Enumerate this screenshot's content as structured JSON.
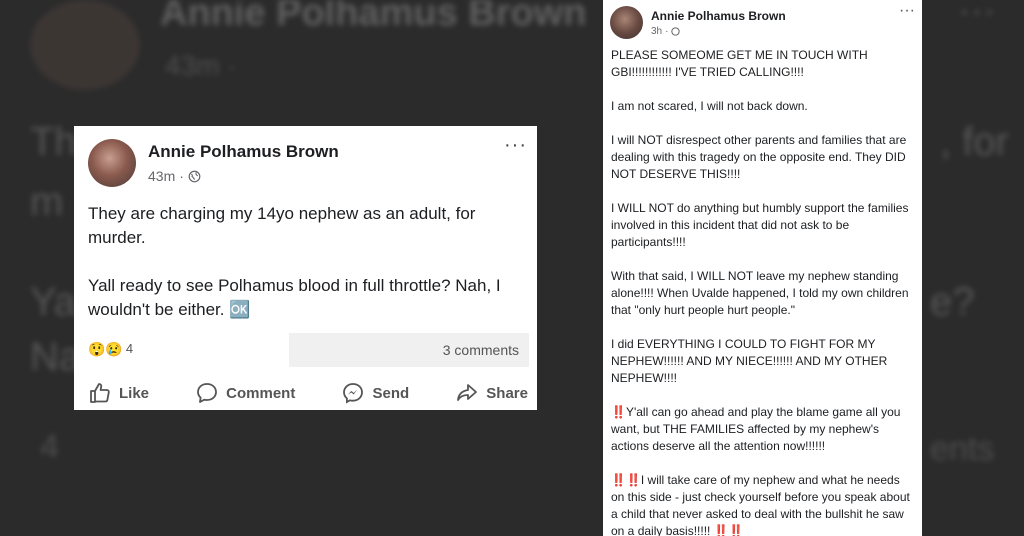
{
  "background": {
    "name": "Annie Polhamus Brown",
    "time": "43m ·",
    "line1_left": "Th",
    "line1_right": ", for",
    "line2": "m",
    "line3": "Ya                                             blo",
    "line3_right": "e?",
    "line4": "Na",
    "reactions_count": "4",
    "comments_fragment": "ents",
    "dots": "···"
  },
  "left_post": {
    "author": "Annie Polhamus Brown",
    "time": "43m",
    "menu": "···",
    "paragraph1": "They are charging my 14yo nephew as an adult, for murder.",
    "paragraph2": "Yall ready to see Polhamus blood in full throttle? Nah, I wouldn't be either. 🆗",
    "reaction_emojis": "😲😢",
    "reactions_count": "4",
    "comments_label": "3 comments",
    "actions": {
      "like": "Like",
      "comment": "Comment",
      "send": "Send",
      "share": "Share"
    }
  },
  "right_post": {
    "author": "Annie Polhamus Brown",
    "time": "3h",
    "menu": "···",
    "p1": "PLEASE SOMEOME GET ME IN TOUCH WITH GBI!!!!!!!!!!!! I'VE TRIED CALLING!!!!",
    "p2": "I am not scared, I will not back down.",
    "p3": "I will NOT disrespect other parents and families that are dealing with this tragedy on the opposite end. They DID NOT DESERVE THIS!!!!",
    "p4": "I WILL NOT do anything but humbly support the families involved in this incident that did not ask to be participants!!!!",
    "p5": "With that said, I WILL NOT leave my nephew standing alone!!!! When Uvalde happened, I told my own children that \"only hurt people hurt people.\"",
    "p6": "I did EVERYTHING I COULD TO FIGHT FOR MY NEPHEW!!!!!! AND MY NIECE!!!!!! AND MY OTHER NEPHEW!!!!",
    "p7_mark": "‼️",
    "p7": "Y'all can go ahead and play the blame game all you want, but THE FAMILIES affected by my nephew's actions deserve all the attention now!!!!!!",
    "p8_mark": "‼️‼️",
    "p8": "I will take care of my nephew and what he needs on this side - just check yourself before you speak about a child that never asked to deal with the bullshit he saw on a daily basis!!!!! ‼️‼️"
  }
}
